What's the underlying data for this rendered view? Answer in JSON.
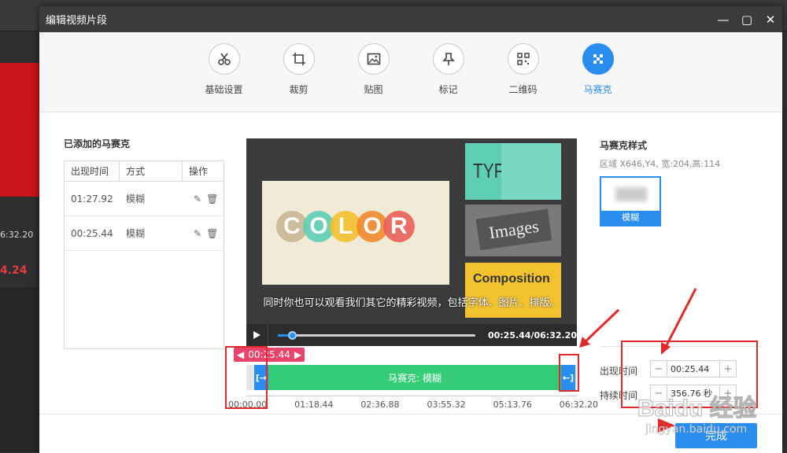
{
  "background": {
    "time": "6:32.20",
    "number": "4.24"
  },
  "dialog": {
    "title": "编辑视频片段",
    "min_icon": "minimize-icon",
    "max_icon": "maximize-icon",
    "close_icon": "close-icon"
  },
  "toolbar": {
    "items": [
      {
        "label": "基础设置",
        "icon": "scissors-icon"
      },
      {
        "label": "裁剪",
        "icon": "crop-icon"
      },
      {
        "label": "贴图",
        "icon": "image-icon"
      },
      {
        "label": "标记",
        "icon": "pin-icon"
      },
      {
        "label": "二维码",
        "icon": "qrcode-icon"
      },
      {
        "label": "马赛克",
        "icon": "mosaic-icon",
        "active": true
      }
    ]
  },
  "list": {
    "title": "已添加的马赛克",
    "headers": [
      "出现时间",
      "方式",
      "操作"
    ],
    "rows": [
      {
        "time": "01:27.92",
        "mode": "模糊"
      },
      {
        "time": "00:25.44",
        "mode": "模糊"
      }
    ]
  },
  "video": {
    "color_word": "COLOR",
    "typ": "TYP",
    "images": "Images",
    "composition": "Composition",
    "subtitle": "同时你也可以观看我们其它的精彩视频，包括字体、图片、排版。",
    "time": "00:25.44/06:32.20",
    "progress": 0.065
  },
  "timeline": {
    "tag": "00:25.44",
    "bar_label": "马赛克: 模糊",
    "ticks": [
      "00:00.00",
      "01:18.44",
      "02:36.88",
      "03:55.32",
      "05:13.76",
      "06:32.20"
    ]
  },
  "mosaic_style": {
    "title": "马赛克样式",
    "info": "区域 X646,Y4, 宽:204,高:114",
    "card_label": "模糊"
  },
  "fields": {
    "appear_label": "出现时间",
    "appear_value": "00:25.44",
    "duration_label": "持续时间",
    "duration_value": "356.76 秒"
  },
  "done_label": "完成",
  "watermark": {
    "main": "Baidu 经验",
    "url": "jingyan.baidu.com"
  },
  "colors": {
    "accent": "#2a8ef0",
    "bar": "#35cc77",
    "tag": "#e8436b",
    "annotation": "#e12a2a"
  }
}
